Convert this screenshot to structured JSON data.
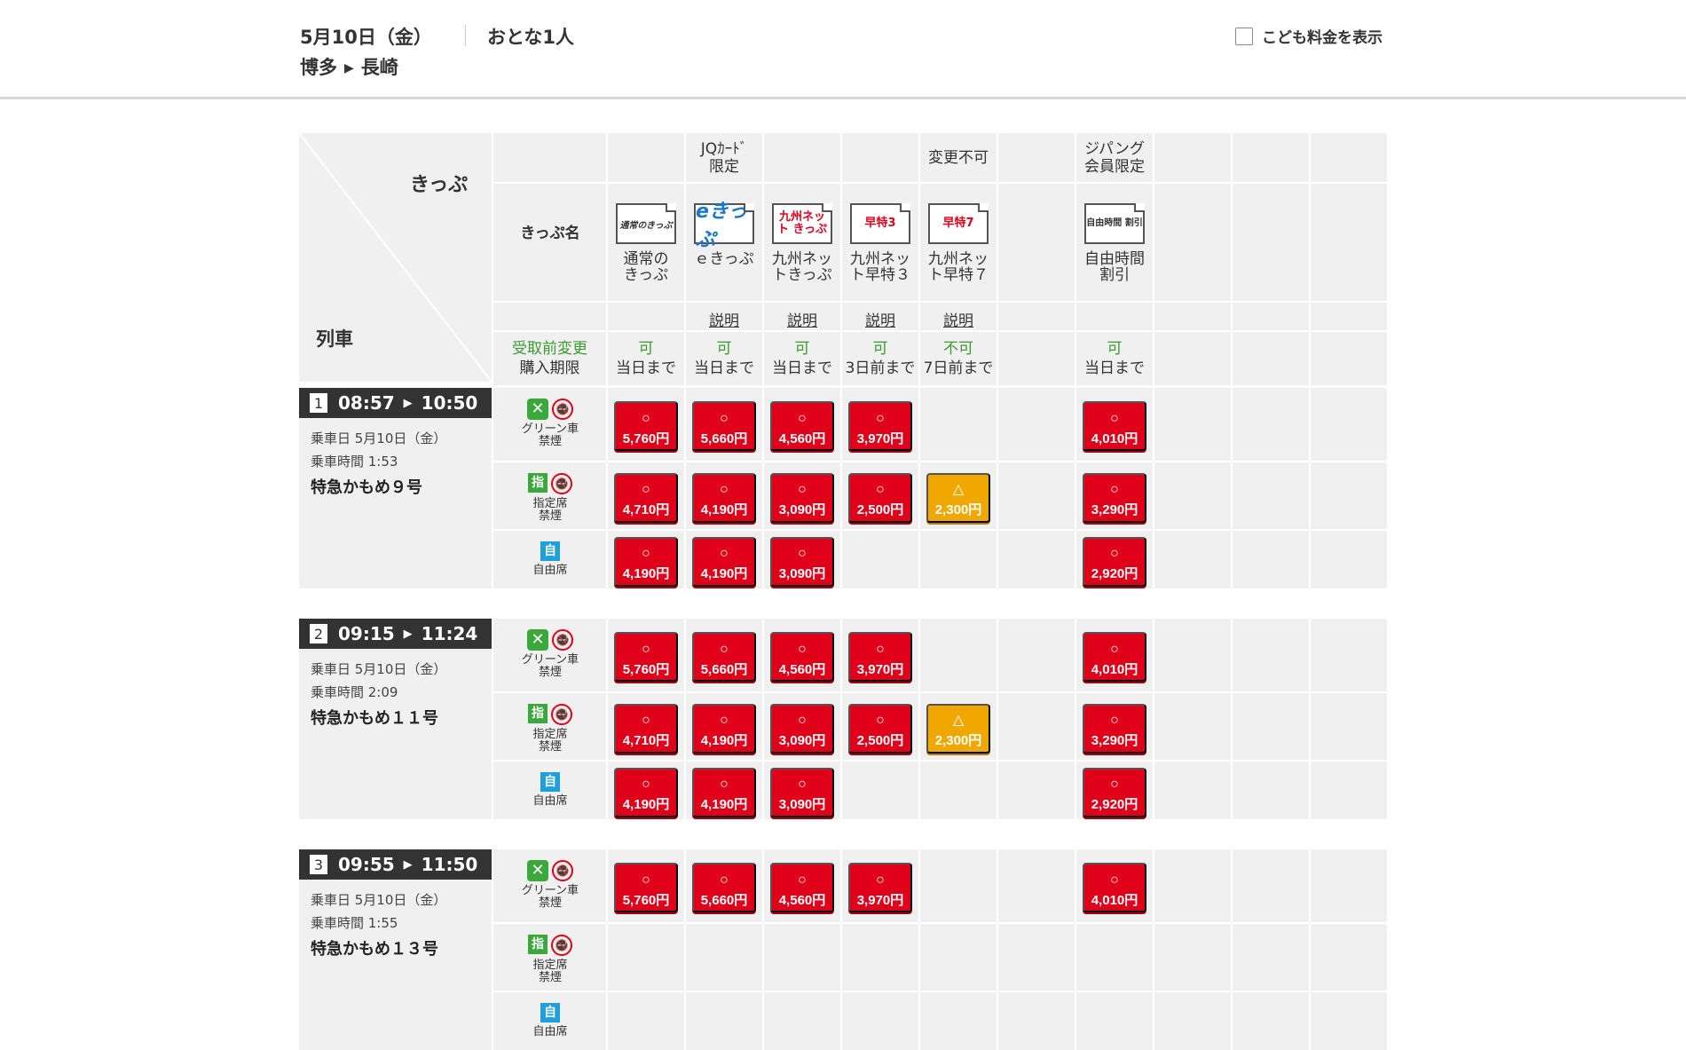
{
  "header": {
    "date": "5月10日（金）",
    "passengers": "おとな1人",
    "from": "博多",
    "to": "長崎",
    "child_fare_label": "こども料金を表示"
  },
  "table": {
    "kippu_label": "きっぷ",
    "ressha_label": "列車",
    "kippu_name_label": "きっぷ名",
    "change_label": "受取前変更",
    "deadline_label": "購入期限",
    "notes": {
      "jq": [
        "JQｶｰﾄﾞ",
        "限定"
      ],
      "henkou": "変更不可",
      "zipangu": [
        "ジパング",
        "会員限定"
      ]
    },
    "tickets": [
      {
        "icon": "通常のきっぷ",
        "name": [
          "通常の",
          "きっぷ"
        ],
        "setsumei": "",
        "change": "可",
        "deadline": "当日まで"
      },
      {
        "icon": "eきっぷ",
        "name": [
          "ｅきっぷ",
          ""
        ],
        "setsumei": "説明",
        "change": "可",
        "deadline": "当日まで"
      },
      {
        "icon": "九州ネット きっぷ",
        "name": [
          "九州ネッ",
          "トきっぷ"
        ],
        "setsumei": "説明",
        "change": "可",
        "deadline": "当日まで"
      },
      {
        "icon": "早特3",
        "name": [
          "九州ネッ",
          "ト早特３"
        ],
        "setsumei": "説明",
        "change": "可",
        "deadline": "3日前まで"
      },
      {
        "icon": "早特7",
        "name": [
          "九州ネッ",
          "ト早特７"
        ],
        "setsumei": "説明",
        "change": "不可",
        "deadline": "7日前まで"
      },
      {
        "icon": "自由時間 割引",
        "name": [
          "自由時間",
          "割引"
        ],
        "setsumei": "",
        "change": "可",
        "deadline": "当日まで"
      }
    ]
  },
  "seat_types": {
    "green": [
      "グリーン車",
      "禁煙"
    ],
    "reserved": [
      "指定席",
      "禁煙"
    ],
    "free": [
      "自由席"
    ],
    "green_icon": "green-car-icon",
    "reserved_icon_text": "指",
    "free_icon_text": "自"
  },
  "trains": [
    {
      "num": "1",
      "dep": "08:57",
      "arr": "10:50",
      "ride_date": "乗車日 5月10日（金）",
      "ride_time": "乗車時間 1:53",
      "name": "特急かもめ９号",
      "green": [
        "5,760円",
        "5,660円",
        "4,560円",
        "3,970円",
        "",
        "4,010円"
      ],
      "reserved": [
        "4,710円",
        "4,190円",
        "3,090円",
        "2,500円",
        "2,300円",
        "3,290円"
      ],
      "free": [
        "4,190円",
        "4,190円",
        "3,090円",
        "",
        "",
        "2,920円"
      ]
    },
    {
      "num": "2",
      "dep": "09:15",
      "arr": "11:24",
      "ride_date": "乗車日 5月10日（金）",
      "ride_time": "乗車時間 2:09",
      "name": "特急かもめ１１号",
      "green": [
        "5,760円",
        "5,660円",
        "4,560円",
        "3,970円",
        "",
        "4,010円"
      ],
      "reserved": [
        "4,710円",
        "4,190円",
        "3,090円",
        "2,500円",
        "2,300円",
        "3,290円"
      ],
      "free": [
        "4,190円",
        "4,190円",
        "3,090円",
        "",
        "",
        "2,920円"
      ]
    },
    {
      "num": "3",
      "dep": "09:55",
      "arr": "11:50",
      "ride_date": "乗車日 5月10日（金）",
      "ride_time": "乗車時間 1:55",
      "name": "特急かもめ１３号",
      "green": [
        "5,760円",
        "5,660円",
        "4,560円",
        "3,970円",
        "",
        "4,010円"
      ]
    }
  ],
  "marks": {
    "ok": "○",
    "few": "△"
  },
  "colors": {
    "price_red": "#e0001a",
    "price_warn": "#f0a800",
    "green_text": "#3a9b2e"
  }
}
